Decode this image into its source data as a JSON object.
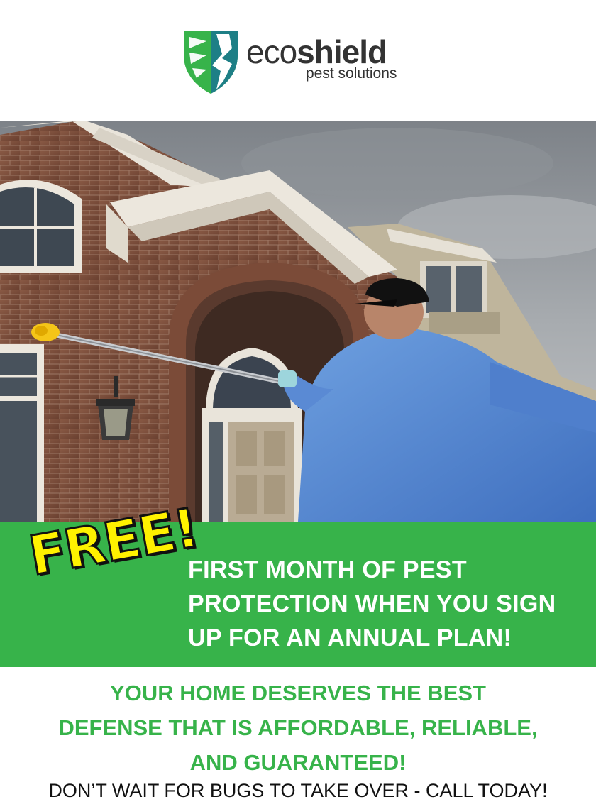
{
  "brand": {
    "name_light": "eco",
    "name_bold": "shield",
    "tagline": "pest solutions",
    "logo_icon": "shield-icon",
    "colors": {
      "green": "#37b34a",
      "teal": "#1e7f86",
      "text": "#333333"
    }
  },
  "hero": {
    "photo": "technician treating brick house with extension pole"
  },
  "promo": {
    "badge": "FREE!",
    "lines": [
      "FIRST MONTH OF PEST",
      "PROTECTION WHEN YOU SIGN",
      "UP FOR AN ANNUAL PLAN!"
    ],
    "badge_color": "#fff200",
    "band_color": "#37b34a"
  },
  "tagline": {
    "lines": [
      "YOUR HOME DESERVES THE BEST",
      "DEFENSE THAT IS AFFORDABLE, RELIABLE,",
      "AND GUARANTEED!"
    ]
  },
  "cta": "DON’T WAIT FOR BUGS TO TAKE OVER - CALL TODAY!"
}
